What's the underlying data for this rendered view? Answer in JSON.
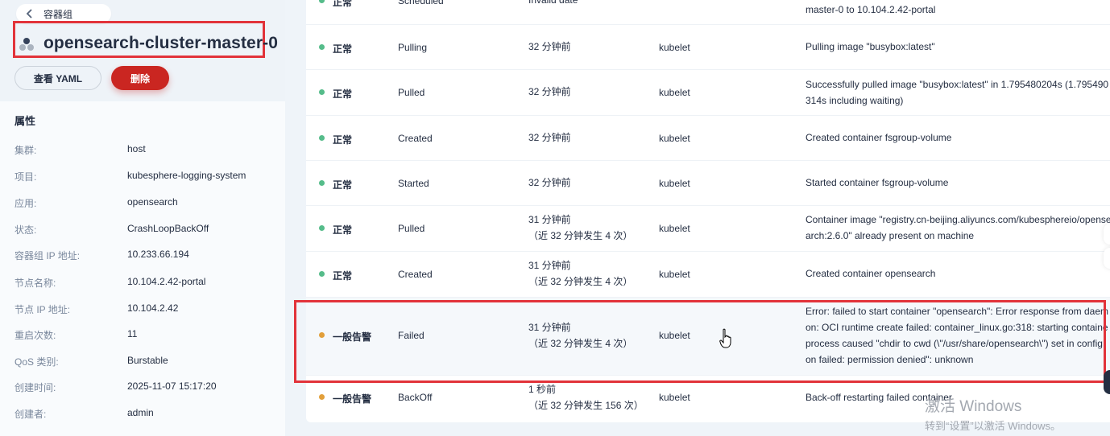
{
  "breadcrumb": {
    "back_label": "容器组"
  },
  "pod": {
    "name": "opensearch-cluster-master-0"
  },
  "actions": {
    "view_yaml": "查看 YAML",
    "delete": "删除"
  },
  "properties": {
    "heading": "属性",
    "items": [
      {
        "key": "集群:",
        "value": "host"
      },
      {
        "key": "项目:",
        "value": "kubesphere-logging-system"
      },
      {
        "key": "应用:",
        "value": "opensearch"
      },
      {
        "key": "状态:",
        "value": "CrashLoopBackOff"
      },
      {
        "key": "容器组 IP 地址:",
        "value": "10.233.66.194"
      },
      {
        "key": "节点名称:",
        "value": "10.104.2.42-portal"
      },
      {
        "key": "节点 IP 地址:",
        "value": "10.104.2.42"
      },
      {
        "key": "重启次数:",
        "value": "11"
      },
      {
        "key": "QoS 类别:",
        "value": "Burstable"
      },
      {
        "key": "创建时间:",
        "value": "2025-11-07 15:17:20"
      },
      {
        "key": "创建者:",
        "value": "admin"
      }
    ]
  },
  "events": [
    {
      "type": "正常",
      "level": "ok",
      "reason": "Scheduled",
      "age": "Invalid date",
      "age2": "",
      "source": "",
      "message": "",
      "message2": "master-0 to 10.104.2.42-portal"
    },
    {
      "type": "正常",
      "level": "ok",
      "reason": "Pulling",
      "age": "32 分钟前",
      "age2": "",
      "source": "kubelet",
      "message": "Pulling image \"busybox:latest\"",
      "message2": ""
    },
    {
      "type": "正常",
      "level": "ok",
      "reason": "Pulled",
      "age": "32 分钟前",
      "age2": "",
      "source": "kubelet",
      "message": "Successfully pulled image \"busybox:latest\" in 1.795480204s (1.795490",
      "message2": "314s including waiting)"
    },
    {
      "type": "正常",
      "level": "ok",
      "reason": "Created",
      "age": "32 分钟前",
      "age2": "",
      "source": "kubelet",
      "message": "Created container fsgroup-volume",
      "message2": ""
    },
    {
      "type": "正常",
      "level": "ok",
      "reason": "Started",
      "age": "32 分钟前",
      "age2": "",
      "source": "kubelet",
      "message": "Started container fsgroup-volume",
      "message2": ""
    },
    {
      "type": "正常",
      "level": "ok",
      "reason": "Pulled",
      "age": "31 分钟前",
      "age2": "（近 32 分钟发生 4 次）",
      "source": "kubelet",
      "message": "Container image \"registry.cn-beijing.aliyuncs.com/kubesphereio/opense",
      "message2": "arch:2.6.0\" already present on machine"
    },
    {
      "type": "正常",
      "level": "ok",
      "reason": "Created",
      "age": "31 分钟前",
      "age2": "（近 32 分钟发生 4 次）",
      "source": "kubelet",
      "message": "Created container opensearch",
      "message2": ""
    },
    {
      "type": "一般告警",
      "level": "warn",
      "reason": "Failed",
      "age": "31 分钟前",
      "age2": "（近 32 分钟发生 4 次）",
      "source": "kubelet",
      "message": "Error: failed to start container \"opensearch\": Error response from daem",
      "message2": "on: OCI runtime create failed: container_linux.go:318: starting containe",
      "message3": "process caused \"chdir to cwd (\\\"/usr/share/opensearch\\\") set in config.",
      "message4": "on failed: permission denied\": unknown"
    },
    {
      "type": "一般告警",
      "level": "warn",
      "reason": "BackOff",
      "age": "1 秒前",
      "age2": "（近 32 分钟发生 156 次）",
      "source": "kubelet",
      "message": "Back-off restarting failed container",
      "message2": ""
    }
  ],
  "os_overlay": {
    "line1": "激活 Windows",
    "line2": "转到“设置”以激活 Windows。"
  },
  "colors": {
    "ok": "#55bc8a",
    "warn": "#e29f3a",
    "danger": "#ca2621",
    "highlight": "#e2333a"
  }
}
